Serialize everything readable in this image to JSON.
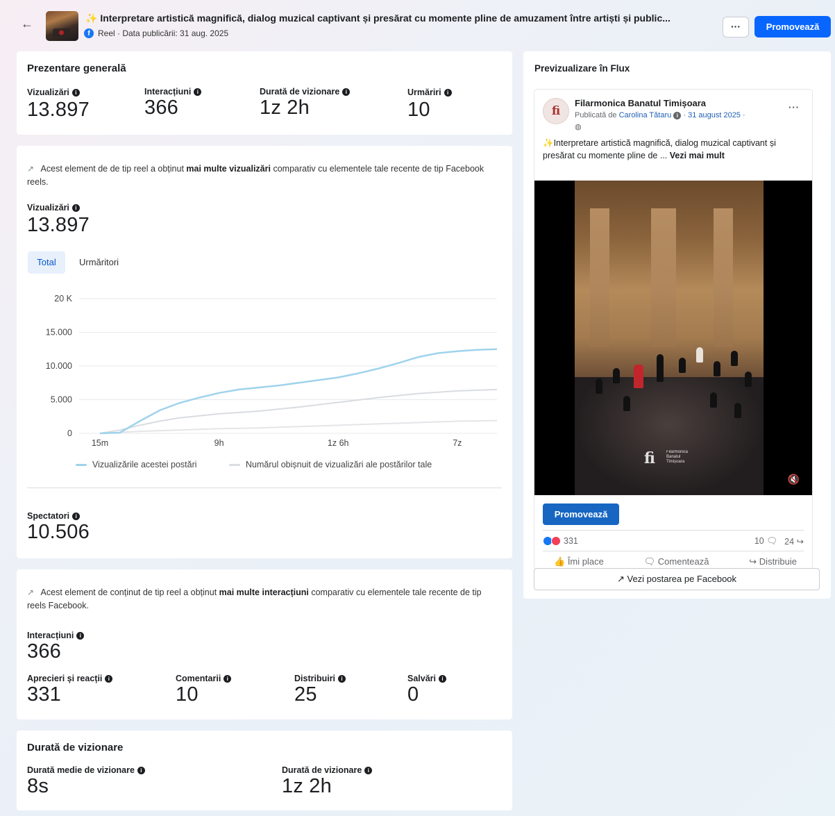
{
  "header": {
    "back_icon": "arrow-left-icon",
    "title": "Interpretare artistică magnifică, dialog muzical captivant și presărat cu momente pline de amuzament între artiști și public...",
    "subtitle": "Reel · Data publicării: 31 aug. 2025",
    "more_label": "···",
    "promote_label": "Promovează"
  },
  "overview": {
    "title": "Prezentare generală",
    "stats": [
      {
        "label": "Vizualizări",
        "value": "13.897"
      },
      {
        "label": "Interacțiuni",
        "value": "366"
      },
      {
        "label": "Durată de vizionare",
        "value": "1z 2h"
      },
      {
        "label": "Urmăriri",
        "value": "10"
      }
    ]
  },
  "views_section": {
    "note_pre": "Acest element de de tip reel a obținut ",
    "note_bold": "mai multe vizualizări",
    "note_post": " comparativ cu elementele tale recente de tip Facebook reels.",
    "views_label": "Vizualizări",
    "views_value": "13.897",
    "tabs": {
      "total": "Total",
      "followers": "Urmăritori"
    },
    "legend": {
      "this_post": "Vizualizările acestei postări",
      "typical": "Numărul obișnuit de vizualizări ale postărilor tale"
    },
    "viewers_label": "Spectatori",
    "viewers_value": "10.506"
  },
  "chart_data": {
    "type": "line",
    "x_ticks": [
      "15m",
      "9h",
      "1z 6h",
      "7z"
    ],
    "y_ticks": [
      "0",
      "5.000",
      "10.000",
      "15.000",
      "20 K"
    ],
    "ylim": [
      0,
      20000
    ],
    "grid": true,
    "legend_position": "bottom",
    "series": [
      {
        "name": "Vizualizările acestei postări",
        "color": "#9fd3ec",
        "x": [
          0,
          0.05,
          0.1,
          0.15,
          0.2,
          0.25,
          0.3,
          0.35,
          0.4,
          0.45,
          0.5,
          0.55,
          0.6,
          0.65,
          0.7,
          0.75,
          0.8,
          0.85,
          0.9,
          0.95,
          1.0
        ],
        "y": [
          0,
          100,
          1800,
          3400,
          4500,
          5300,
          6000,
          6500,
          6800,
          7100,
          7500,
          7900,
          8300,
          8900,
          9600,
          10400,
          11300,
          11900,
          12200,
          12400,
          12500
        ]
      },
      {
        "name": "Numărul obișnuit de vizualizări ale postărilor tale",
        "color": "#d9dce0",
        "x": [
          0,
          0.05,
          0.1,
          0.15,
          0.2,
          0.3,
          0.4,
          0.5,
          0.6,
          0.7,
          0.8,
          0.9,
          1.0
        ],
        "y": [
          0,
          500,
          1200,
          1800,
          2300,
          2900,
          3300,
          3900,
          4600,
          5300,
          5900,
          6300,
          6500
        ]
      },
      {
        "name": "",
        "color": "#e3e5e8",
        "x": [
          0,
          0.1,
          0.2,
          0.3,
          0.4,
          0.5,
          0.6,
          0.7,
          0.8,
          0.9,
          1.0
        ],
        "y": [
          0,
          300,
          500,
          700,
          800,
          1000,
          1200,
          1400,
          1600,
          1800,
          1900
        ]
      }
    ]
  },
  "interactions_section": {
    "note_pre": "Acest element de conținut de tip reel a obținut ",
    "note_bold": "mai multe interacțiuni",
    "note_post": " comparativ cu elementele tale recente de tip reels Facebook.",
    "label": "Interacțiuni",
    "value": "366",
    "stats": [
      {
        "label": "Aprecieri și reacții",
        "value": "331"
      },
      {
        "label": "Comentarii",
        "value": "10"
      },
      {
        "label": "Distribuiri",
        "value": "25"
      },
      {
        "label": "Salvări",
        "value": "0"
      }
    ]
  },
  "watch_time": {
    "title": "Durată de vizionare",
    "stats": [
      {
        "label": "Durată medie de vizionare",
        "value": "8s"
      },
      {
        "label": "Durată de vizionare",
        "value": "1z 2h"
      }
    ]
  },
  "preview": {
    "title": "Previzualizare în Flux",
    "page_name": "Filarmonica Banatul Timișoara",
    "published_by_prefix": "Publicată de ",
    "published_by": "Carolina Tătaru",
    "date": "· 31 august 2025 ·",
    "post_text": "Interpretare artistică magnifică, dialog muzical captivant și presărat cu momente pline de ...",
    "see_more": "Vezi mai mult",
    "watermark": "Filarmonica\nBanatul\nTimișoara",
    "promote_label": "Promovează",
    "reactions_count": "331",
    "comments_count": "10",
    "shares_count": "24",
    "actions": {
      "like": "Îmi place",
      "comment": "Comentează",
      "share": "Distribuie"
    },
    "view_on_facebook": "Vezi postarea pe Facebook"
  }
}
